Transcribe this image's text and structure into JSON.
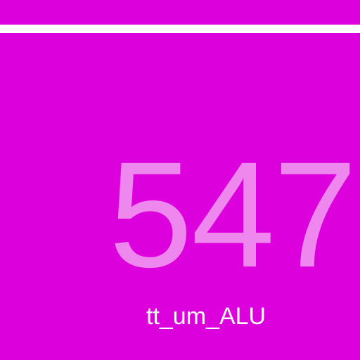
{
  "display": {
    "number": "547",
    "label": "tt_um_ALU"
  },
  "colors": {
    "background": "#dc00dc",
    "divider": "#ffffff",
    "number": "#ee88ee",
    "label": "#ffffff"
  }
}
